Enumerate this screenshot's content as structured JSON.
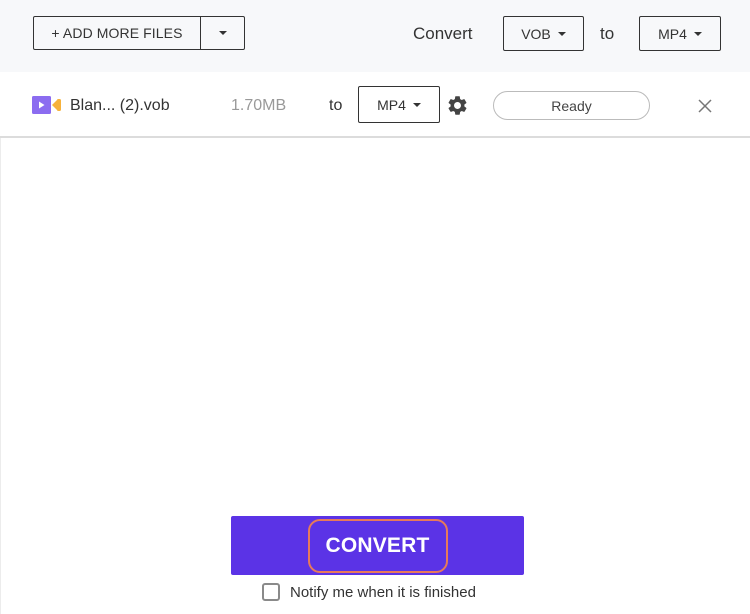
{
  "toolbar": {
    "add_files_label": "+ ADD MORE FILES",
    "add_files_menu_icon": "caret-down-icon",
    "convert_label": "Convert",
    "source_format": "VOB",
    "to_label": "to",
    "target_format": "MP4"
  },
  "files": [
    {
      "icon": "video-file-icon",
      "name": "Blan... (2).vob",
      "size": "1.70MB",
      "to_label": "to",
      "target_format": "MP4",
      "settings_icon": "gear-icon",
      "status": "Ready",
      "remove_icon": "close-icon"
    }
  ],
  "footer": {
    "convert_label": "CONVERT",
    "notify_label": "Notify me when it is finished",
    "notify_checked": false
  },
  "colors": {
    "accent": "#5b33e6",
    "highlight_outline": "#e77a5a",
    "icon_purple": "#8b6cf0",
    "icon_orange": "#f7b23b",
    "toolbar_bg": "#f7f8fa"
  }
}
